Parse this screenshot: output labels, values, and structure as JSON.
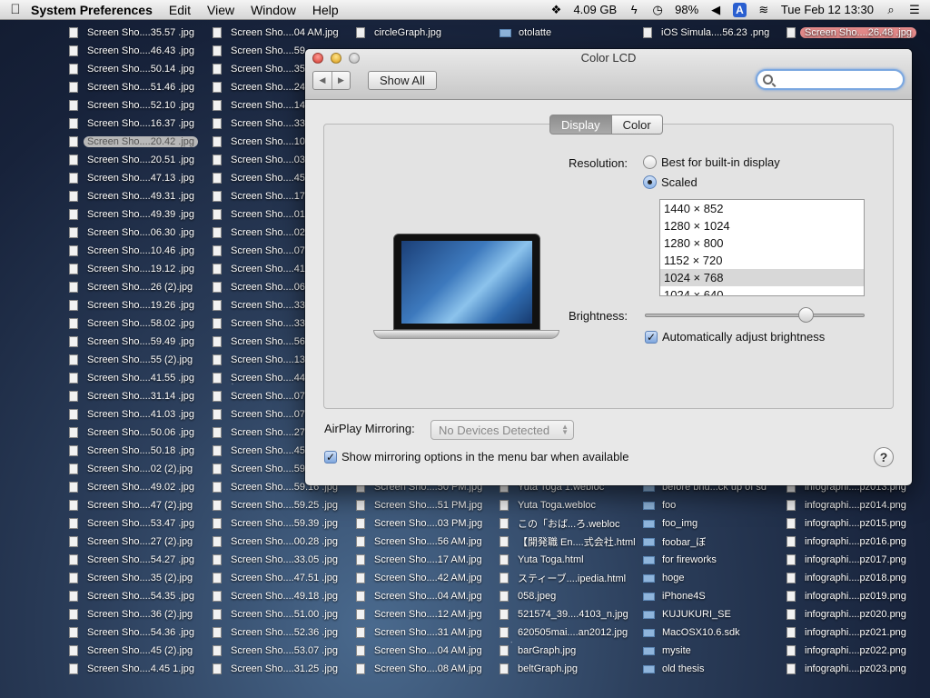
{
  "menubar": {
    "apple": "",
    "app_name": "System Preferences",
    "items": [
      "Edit",
      "View",
      "Window",
      "Help"
    ],
    "dropbox_storage": "4.09 GB",
    "battery": "98%",
    "input_source": "A",
    "datetime": "Tue Feb 12  13:30"
  },
  "window": {
    "title": "Color LCD",
    "show_all": "Show All",
    "search_placeholder": "",
    "tabs": [
      "Display",
      "Color"
    ],
    "resolution_label": "Resolution:",
    "radio_best": "Best for built-in display",
    "radio_scaled": "Scaled",
    "resolutions": [
      "1440 × 852",
      "1280 × 1024",
      "1280 × 800",
      "1152 × 720",
      "1024 × 768",
      "1024 × 640"
    ],
    "selected_resolution": "1024 × 768",
    "brightness_label": "Brightness:",
    "brightness_level": 0.73,
    "auto_brightness": "Automatically adjust brightness",
    "airplay_label": "AirPlay Mirroring:",
    "airplay_value": "No Devices Detected",
    "mirror_option": "Show mirroring options in the menu bar when available",
    "help": "?"
  },
  "desktop": {
    "col1": [
      "Screen Sho....35.57 .jpg",
      "Screen Sho....46.43 .jpg",
      "Screen Sho....50.14 .jpg",
      "Screen Sho....51.46 .jpg",
      "Screen Sho....52.10 .jpg",
      "Screen Sho....16.37 .jpg",
      "Screen Sho....20.42 .jpg",
      "Screen Sho....20.51 .jpg",
      "Screen Sho....47.13 .jpg",
      "Screen Sho....49.31 .jpg",
      "Screen Sho....49.39 .jpg",
      "Screen Sho....06.30 .jpg",
      "Screen Sho....10.46 .jpg",
      "Screen Sho....19.12 .jpg",
      "Screen Sho....26  (2).jpg",
      "Screen Sho....19.26 .jpg",
      "Screen Sho....58.02 .jpg",
      "Screen Sho....59.49 .jpg",
      "Screen Sho....55  (2).jpg",
      "Screen Sho....41.55 .jpg",
      "Screen Sho....31.14 .jpg",
      "Screen Sho....41.03 .jpg",
      "Screen Sho....50.06 .jpg",
      "Screen Sho....50.18 .jpg",
      "Screen Sho....02  (2).jpg",
      "Screen Sho....49.02 .jpg",
      "Screen Sho....47  (2).jpg",
      "Screen Sho....53.47 .jpg",
      "Screen Sho....27  (2).jpg",
      "Screen Sho....54.27 .jpg",
      "Screen Sho....35  (2).jpg",
      "Screen Sho....54.35 .jpg",
      "Screen Sho....36  (2).jpg",
      "Screen Sho....54.36 .jpg",
      "Screen Sho....45  (2).jpg",
      "Screen Sho....4.45  1.jpg"
    ],
    "col2": [
      "Screen Sho....04 AM.jpg",
      "Screen Sho....59",
      "Screen Sho....35",
      "Screen Sho....24",
      "Screen Sho....14",
      "Screen Sho....33",
      "Screen Sho....10",
      "Screen Sho....03",
      "Screen Sho....45",
      "Screen Sho....17",
      "Screen Sho....01",
      "Screen Sho....02",
      "Screen Sho....07",
      "Screen Sho....41",
      "Screen Sho....06",
      "Screen Sho....33",
      "Screen Sho....33",
      "Screen Sho....56",
      "Screen Sho....13",
      "Screen Sho....44",
      "Screen Sho....07",
      "Screen Sho....07",
      "Screen Sho....27",
      "Screen Sho....45",
      "Screen Sho....59",
      "Screen Sho....59.16 .jpg",
      "Screen Sho....59.25 .jpg",
      "Screen Sho....59.39 .jpg",
      "Screen Sho....00.28 .jpg",
      "Screen Sho....33.05 .jpg",
      "Screen Sho....47.51 .jpg",
      "Screen Sho....49.18 .jpg",
      "Screen Sho....51.00 .jpg",
      "Screen Sho....52.36 .jpg",
      "Screen Sho....53.07 .jpg",
      "Screen Sho....31.25 .jpg"
    ],
    "col3_top": [
      "circleGraph.jpg"
    ],
    "col3": [
      "Screen Sho....50 PM.jpg",
      "Screen Sho....51 PM.jpg",
      "Screen Sho....03 PM.jpg",
      "Screen Sho....56 AM.jpg",
      "Screen Sho....17 AM.jpg",
      "Screen Sho....42 AM.jpg",
      "Screen Sho....04 AM.jpg",
      "Screen Sho....12 AM.jpg",
      "Screen Sho....31 AM.jpg",
      "Screen Sho....04 AM.jpg",
      "Screen Sho....08 AM.jpg"
    ],
    "col4_top": [
      "otolatte"
    ],
    "col4": [
      "Yuta Toga 1.webloc",
      "Yuta Toga.webloc",
      "この「おば...ろ.webloc",
      "【開発職 En....式会社.html",
      "Yuta Toga.html",
      "スティーブ....ipedia.html",
      "058.jpeg",
      "521574_39....4103_n.jpg",
      "620505mai....an2012.jpg",
      "barGraph.jpg",
      "beltGraph.jpg"
    ],
    "col5_top": [
      "iOS Simula....56.23 .png"
    ],
    "col5": [
      "before bhu...ck up of sd",
      "foo",
      "foo_img",
      "foobar_ぼ",
      "for fireworks",
      "hoge",
      "iPhone4S",
      "KUJUKURI_SE",
      "MacOSX10.6.sdk",
      "mysite",
      "old thesis"
    ],
    "col6_top": [
      "Screen Sho....26.48 .jpg"
    ],
    "col6": [
      "infographi....pz013.png",
      "infographi....pz014.png",
      "infographi....pz015.png",
      "infographi....pz016.png",
      "infographi....pz017.png",
      "infographi....pz018.png",
      "infographi....pz019.png",
      "infographi....pz020.png",
      "infographi....pz021.png",
      "infographi....pz022.png",
      "infographi....pz023.png"
    ]
  }
}
